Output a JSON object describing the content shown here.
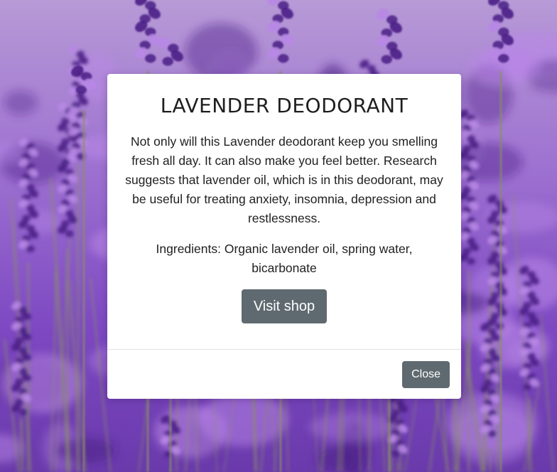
{
  "background": {
    "image": "lavender-field-photo",
    "colors": {
      "sky": "#b79ad6",
      "mid": "#8b5ac8",
      "flower_dark": "#4a1f86",
      "flower_light": "#b887e6",
      "stem": "#8a8f6a"
    }
  },
  "modal": {
    "title": "LAVENDER DEODORANT",
    "description": "Not only will this Lavender deodorant keep you smelling fresh all day. It can also make you feel better. Research suggests that lavender oil, which is in this deodorant, may be useful for treating anxiety, insomnia, depression and restlessness.",
    "ingredients": "Ingredients: Organic lavender oil, spring water, bicarbonate",
    "visit_button_label": "Visit shop",
    "close_button_label": "Close"
  },
  "colors": {
    "button_bg": "#5f6a70",
    "button_text": "#ffffff",
    "modal_bg": "#ffffff",
    "text": "#212121"
  }
}
